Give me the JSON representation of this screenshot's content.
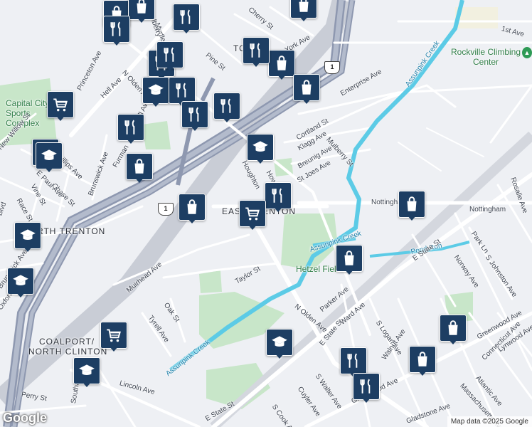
{
  "map": {
    "neighborhoods": [
      "EAST TRENTON",
      "NORTH TRENTON",
      "COALPORT/",
      "NORTH CLINTON",
      "TO"
    ],
    "parks": [
      "Capital City Sports Complex",
      "Hetzel Field"
    ],
    "poi": [
      "Rockville Climbing Center"
    ],
    "water": [
      "Assunpink Creek",
      "Assunpink Creek",
      "Assunpink Creek",
      "Pond Run"
    ],
    "streets": [
      "Princeton Ave",
      "N Olden Ave",
      "Hell Ave",
      "Mulberry St",
      "Enterprise Ave",
      "Cortland St",
      "Klagg Ave",
      "Breunig Ave",
      "St Joes Ave",
      "Houghton",
      "Nottingham Way",
      "Nottingham",
      "Taylor St",
      "Muirhead Ave",
      "Oak St",
      "Tyrell Ave",
      "N Olden Ave",
      "E State St",
      "Parker Ave",
      "Ward Ave",
      "E State St",
      "Norway Ave",
      "S Johnston Ave",
      "Park Ln",
      "Rosalie Ave",
      "Greenwood Ave",
      "Lynwood Ave",
      "Connecticut Ave",
      "Atlantic Ave",
      "Massachusetts Ave",
      "Greenwood Ave",
      "S Logan Ave",
      "S Walter Ave",
      "Cuyler Ave",
      "S Cook Ave",
      "E State St",
      "Lincoln Ave",
      "Perry St",
      "Southard St",
      "Chase St",
      "Vine St",
      "Race St",
      "E Paul Ave",
      "Phillips Ave",
      "Brunswick Ave",
      "New Willow St",
      "Oxford St",
      "Pine St",
      "Cherry St",
      "York Ave",
      "Myrtle",
      "Mulberry",
      "1st Ave",
      "Gladstone Ave",
      "Blvd",
      "Brunswick Ave",
      "Walnut Ave",
      "Furman",
      "Ewell Ave",
      "Howard Ave"
    ],
    "route_shields": [
      "1",
      "1"
    ],
    "markers": [
      {
        "icon": "shopping-bag-icon"
      },
      {
        "icon": "shopping-bag-icon"
      },
      {
        "icon": "shopping-bag-icon"
      },
      {
        "icon": "restaurant-icon"
      },
      {
        "icon": "restaurant-icon"
      },
      {
        "icon": "shopping-bag-icon"
      },
      {
        "icon": "restaurant-icon"
      },
      {
        "icon": "restaurant-icon"
      },
      {
        "icon": "restaurant-icon"
      },
      {
        "icon": "shopping-bag-icon"
      },
      {
        "icon": "school-icon"
      },
      {
        "icon": "restaurant-icon"
      },
      {
        "icon": "restaurant-icon"
      },
      {
        "icon": "shopping-cart-icon"
      },
      {
        "icon": "restaurant-icon"
      },
      {
        "icon": "restaurant-icon"
      },
      {
        "icon": "shopping-cart-icon"
      },
      {
        "icon": "school-icon"
      },
      {
        "icon": "shopping-bag-icon"
      },
      {
        "icon": "school-icon"
      },
      {
        "icon": "restaurant-icon"
      },
      {
        "icon": "shopping-bag-icon"
      },
      {
        "icon": "shopping-cart-icon"
      },
      {
        "icon": "shopping-bag-icon"
      },
      {
        "icon": "school-icon"
      },
      {
        "icon": "school-icon"
      },
      {
        "icon": "shopping-bag-icon"
      },
      {
        "icon": "school-icon"
      },
      {
        "icon": "shopping-cart-icon"
      },
      {
        "icon": "shopping-bag-icon"
      },
      {
        "icon": "school-icon"
      },
      {
        "icon": "restaurant-icon"
      },
      {
        "icon": "shopping-bag-icon"
      },
      {
        "icon": "restaurant-icon"
      }
    ],
    "logo": "Google",
    "attribution": "Map data ©2025 Google"
  },
  "colors": {
    "marker": "#1d3e63",
    "park": "#c8e6c9",
    "water": "#5ccbe6",
    "highway": "#9aa3b8",
    "road": "#ffffff"
  }
}
